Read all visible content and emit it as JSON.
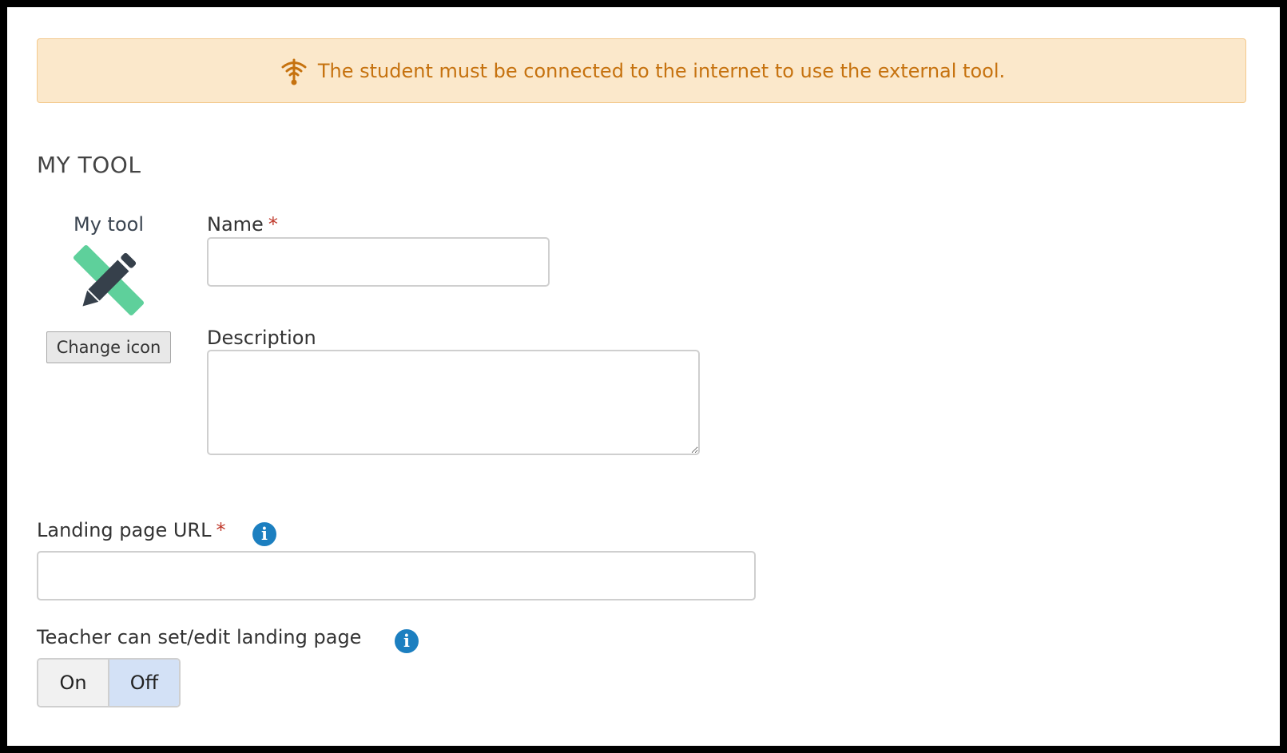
{
  "banner": {
    "text": "The student must be connected to the internet to use the external tool.",
    "icon": "wifi-signal-icon",
    "color": "#c6720f"
  },
  "section": {
    "title": "MY TOOL"
  },
  "tool": {
    "name": "My tool",
    "icon": "pencil-ruler-icon",
    "change_icon_label": "Change icon"
  },
  "form": {
    "name_label": "Name",
    "name_value": "",
    "description_label": "Description",
    "description_value": "",
    "required_mark": "*",
    "landing_url_label": "Landing page URL",
    "landing_url_value": "",
    "teacher_edit_label": "Teacher can set/edit landing page",
    "toggle": {
      "on_label": "On",
      "off_label": "Off",
      "selected": "Off"
    }
  },
  "colors": {
    "required": "#c0392b",
    "info": "#1c7fc0",
    "toggle_selected": "#d3e1f6"
  }
}
